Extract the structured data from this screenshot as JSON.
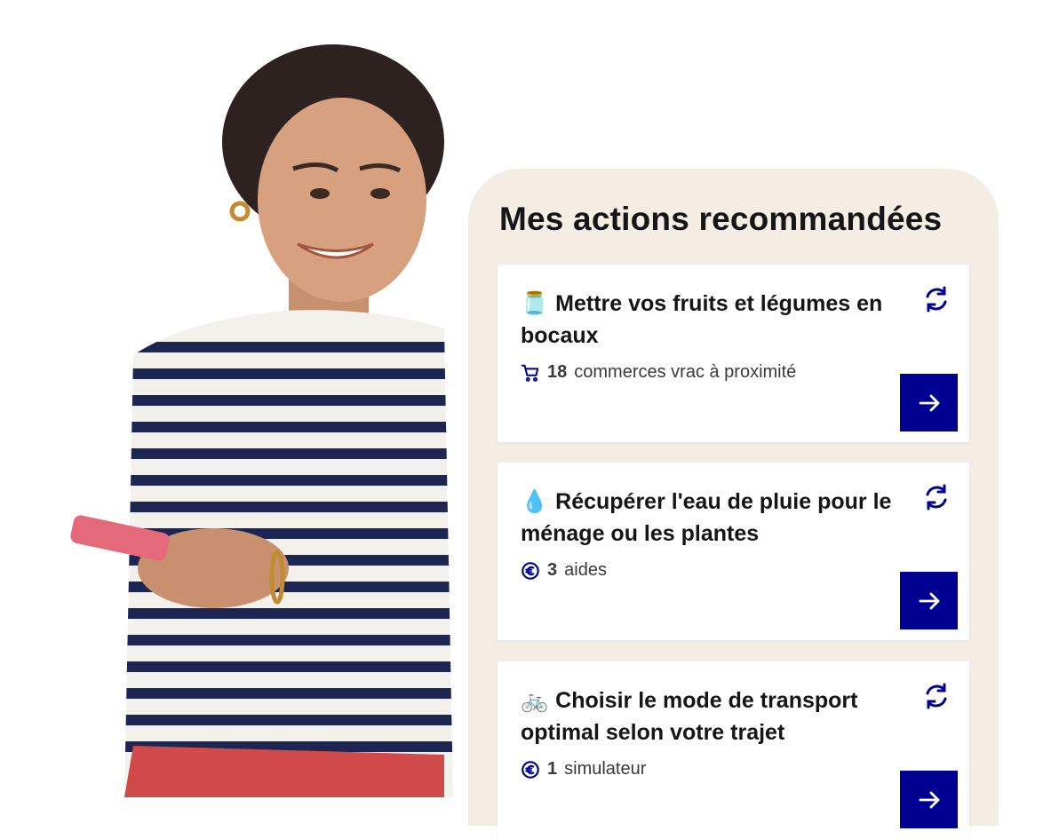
{
  "panel": {
    "title": "Mes actions recommandées"
  },
  "cards": [
    {
      "emoji": "🫙",
      "title": "Mettre vos fruits et légumes en bocaux",
      "meta_icon": "cart-icon",
      "meta_count": "18",
      "meta_text": "commerces vrac à proximité"
    },
    {
      "emoji": "💧",
      "title": "Récupérer l'eau de pluie pour le ménage ou les plantes",
      "meta_icon": "euro-icon",
      "meta_count": "3",
      "meta_text": "aides"
    },
    {
      "emoji": "🚲",
      "title": "Choisir le mode de transport optimal selon votre trajet",
      "meta_icon": "euro-icon",
      "meta_count": "1",
      "meta_text": "simulateur"
    }
  ],
  "colors": {
    "accent": "#000091",
    "panel_background": "#f3ede4",
    "card_background": "#ffffff",
    "text": "#161616"
  }
}
